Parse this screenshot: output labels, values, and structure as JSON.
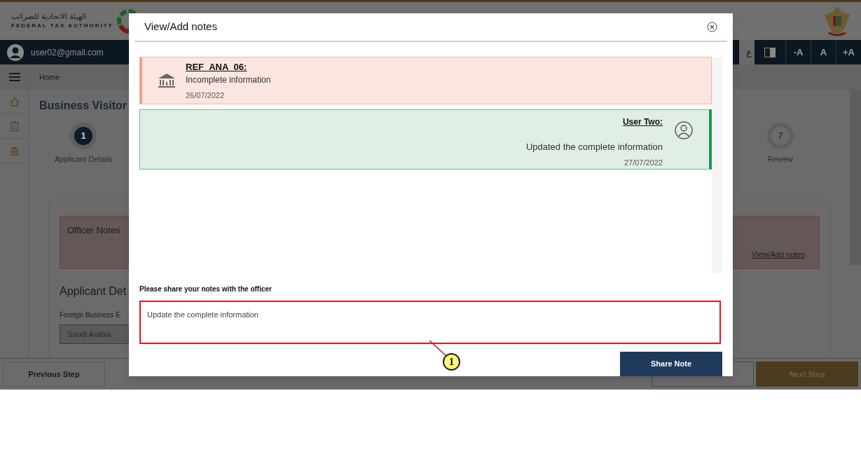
{
  "header": {
    "logo_arabic": "الهيئة الاتحادية للضرائب",
    "logo_english": "FEDERAL TAX AUTHORITY"
  },
  "user_bar": {
    "email": "user02@gmail.com",
    "language": "ع",
    "font_buttons": [
      "-A",
      "A",
      "+A"
    ]
  },
  "breadcrumb": "Home",
  "page_title": "Business Visitor",
  "steps": [
    {
      "number": "1",
      "label": "Applicant Details",
      "selected": true
    },
    {
      "number": "7",
      "label": "Review",
      "selected": false
    }
  ],
  "officer_notes": {
    "title": "Officer Notes",
    "link": "View/Add notes"
  },
  "section": {
    "title": "Applicant Det",
    "field_label": "Foreign Business E",
    "field_value": "Saudi Arabia"
  },
  "footer": {
    "previous": "Previous Step",
    "next": "Next Step"
  },
  "modal": {
    "title": "View/Add notes",
    "notes": [
      {
        "kind": "officer",
        "author": "REF_ANA_06:",
        "text": "Incomplete information",
        "date": "26/07/2022"
      },
      {
        "kind": "user",
        "author": "User Two:",
        "text": "Updated the complete information",
        "date": "27/07/2022"
      }
    ],
    "input_label": "Please share your notes with the officer",
    "input_value": "Update the complete information",
    "button": "Share Note"
  },
  "callouts": [
    {
      "number": "1"
    }
  ]
}
